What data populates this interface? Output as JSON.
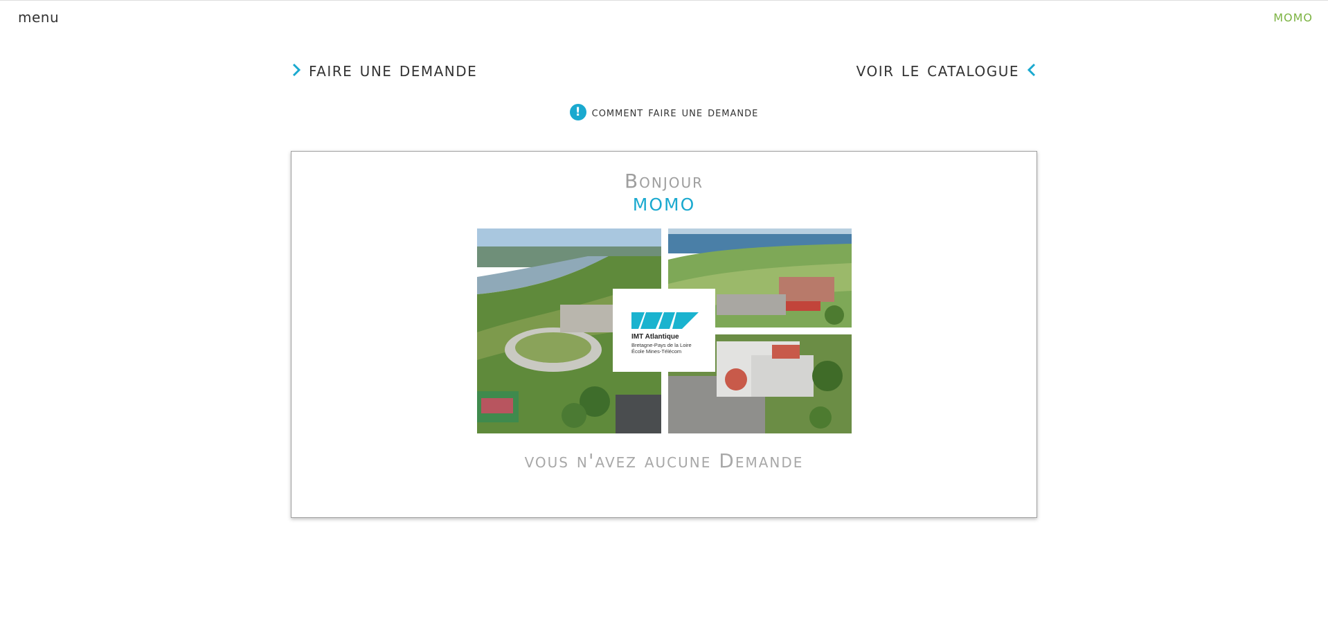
{
  "topbar": {
    "menu_label": "menu",
    "user_label": "MOMO"
  },
  "actions": {
    "new_request_label": "Faire une Demande",
    "catalog_label": "Voir le Catalogue"
  },
  "help": {
    "icon_glyph": "!",
    "label": "comment faire une demande"
  },
  "card": {
    "greeting": "Bonjour",
    "username": "MOMO",
    "empty_message": "vous n'avez aucune Demande",
    "logo": {
      "title": "IMT Atlantique",
      "line1": "Bretagne-Pays de la Loire",
      "line2": "École Mines-Télécom"
    }
  },
  "colors": {
    "accent": "#1aa9cf",
    "user": "#7cb342",
    "muted": "#9e9e9e",
    "text": "#333333"
  },
  "icons": {
    "chevron_right": "chevron-right-icon",
    "chevron_left": "chevron-left-icon",
    "info": "exclamation-icon"
  }
}
